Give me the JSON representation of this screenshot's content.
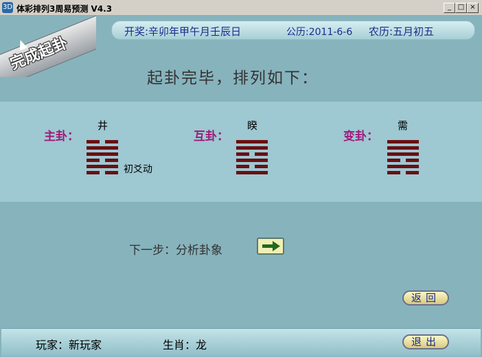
{
  "window": {
    "title": "体彩排列3周易预测 V4.3",
    "icon": "app-icon",
    "controls": {
      "minimize": "_",
      "maximize": "□",
      "close": "×"
    }
  },
  "infobar": {
    "kaijiang": "开奖:辛卯年甲午月壬辰日",
    "gongli": "公历:2011-6-6",
    "nongli": "农历:五月初五"
  },
  "corner_badge": "完成起卦",
  "heading": "起卦完毕，排列如下：",
  "gua": [
    {
      "label": "主卦：",
      "name": "井",
      "lines": [
        0,
        1,
        0,
        1,
        1,
        0
      ],
      "note": "初爻动"
    },
    {
      "label": "互卦：",
      "name": "睽",
      "lines": [
        1,
        0,
        1,
        0,
        1,
        1
      ]
    },
    {
      "label": "变卦：",
      "name": "需",
      "lines": [
        0,
        1,
        0,
        1,
        1,
        1
      ]
    }
  ],
  "next_step": {
    "label": "下一步：分析卦象",
    "icon": "arrow-right-icon"
  },
  "buttons": {
    "back": "返回",
    "exit": "退出"
  },
  "status": {
    "player": "玩家：新玩家",
    "zodiac": "生肖：龙"
  },
  "colors": {
    "hexagram": "#6a0f12",
    "gua_label": "#a01a7a",
    "info_text": "#1a2a8a"
  }
}
